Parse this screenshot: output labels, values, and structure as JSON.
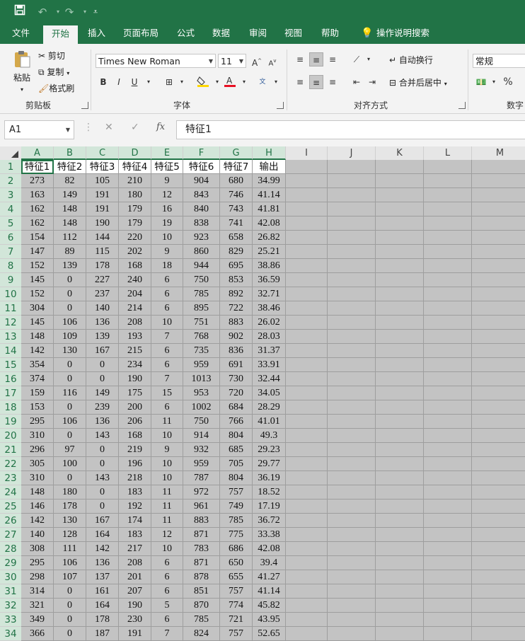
{
  "quick_access": {
    "save_icon": "save-icon",
    "undo_icon": "undo-icon",
    "redo_icon": "redo-icon"
  },
  "tabs": [
    "文件",
    "开始",
    "插入",
    "页面布局",
    "公式",
    "数据",
    "审阅",
    "视图",
    "帮助"
  ],
  "tell_me": "操作说明搜索",
  "ribbon": {
    "clipboard": {
      "paste": "粘贴",
      "cut": "剪切",
      "copy": "复制",
      "format_painter": "格式刷",
      "label": "剪贴板"
    },
    "font": {
      "font_name": "Times New Roman",
      "font_size": "11",
      "bold": "B",
      "italic": "I",
      "underline": "U",
      "font_color_accent": "#e81123",
      "fill_color_accent": "#ffd700",
      "label": "字体"
    },
    "alignment": {
      "wrap_text": "自动换行",
      "merge_center": "合并后居中",
      "label": "对齐方式"
    },
    "number": {
      "format": "常规",
      "percent": "%",
      "label": "数字"
    }
  },
  "formula_bar": {
    "name_box": "A1",
    "cancel": "✕",
    "enter": "✓",
    "fx": "fx",
    "content": "特征1"
  },
  "columns": [
    "A",
    "B",
    "C",
    "D",
    "E",
    "F",
    "G",
    "H",
    "I",
    "J",
    "K",
    "L",
    "M"
  ],
  "rows": [
    "1",
    "2",
    "3",
    "4",
    "5",
    "6",
    "7",
    "8",
    "9",
    "10",
    "11",
    "12",
    "13",
    "14",
    "15",
    "16",
    "17",
    "18",
    "19",
    "20",
    "21",
    "22",
    "23",
    "24",
    "25",
    "26",
    "27",
    "28",
    "29",
    "30",
    "31",
    "32",
    "33",
    "34"
  ],
  "headers": [
    "特征1",
    "特征2",
    "特征3",
    "特征4",
    "特征5",
    "特征6",
    "特征7",
    "输出"
  ],
  "data": [
    [
      "273",
      "82",
      "105",
      "210",
      "9",
      "904",
      "680",
      "34.99"
    ],
    [
      "163",
      "149",
      "191",
      "180",
      "12",
      "843",
      "746",
      "41.14"
    ],
    [
      "162",
      "148",
      "191",
      "179",
      "16",
      "840",
      "743",
      "41.81"
    ],
    [
      "162",
      "148",
      "190",
      "179",
      "19",
      "838",
      "741",
      "42.08"
    ],
    [
      "154",
      "112",
      "144",
      "220",
      "10",
      "923",
      "658",
      "26.82"
    ],
    [
      "147",
      "89",
      "115",
      "202",
      "9",
      "860",
      "829",
      "25.21"
    ],
    [
      "152",
      "139",
      "178",
      "168",
      "18",
      "944",
      "695",
      "38.86"
    ],
    [
      "145",
      "0",
      "227",
      "240",
      "6",
      "750",
      "853",
      "36.59"
    ],
    [
      "152",
      "0",
      "237",
      "204",
      "6",
      "785",
      "892",
      "32.71"
    ],
    [
      "304",
      "0",
      "140",
      "214",
      "6",
      "895",
      "722",
      "38.46"
    ],
    [
      "145",
      "106",
      "136",
      "208",
      "10",
      "751",
      "883",
      "26.02"
    ],
    [
      "148",
      "109",
      "139",
      "193",
      "7",
      "768",
      "902",
      "28.03"
    ],
    [
      "142",
      "130",
      "167",
      "215",
      "6",
      "735",
      "836",
      "31.37"
    ],
    [
      "354",
      "0",
      "0",
      "234",
      "6",
      "959",
      "691",
      "33.91"
    ],
    [
      "374",
      "0",
      "0",
      "190",
      "7",
      "1013",
      "730",
      "32.44"
    ],
    [
      "159",
      "116",
      "149",
      "175",
      "15",
      "953",
      "720",
      "34.05"
    ],
    [
      "153",
      "0",
      "239",
      "200",
      "6",
      "1002",
      "684",
      "28.29"
    ],
    [
      "295",
      "106",
      "136",
      "206",
      "11",
      "750",
      "766",
      "41.01"
    ],
    [
      "310",
      "0",
      "143",
      "168",
      "10",
      "914",
      "804",
      "49.3"
    ],
    [
      "296",
      "97",
      "0",
      "219",
      "9",
      "932",
      "685",
      "29.23"
    ],
    [
      "305",
      "100",
      "0",
      "196",
      "10",
      "959",
      "705",
      "29.77"
    ],
    [
      "310",
      "0",
      "143",
      "218",
      "10",
      "787",
      "804",
      "36.19"
    ],
    [
      "148",
      "180",
      "0",
      "183",
      "11",
      "972",
      "757",
      "18.52"
    ],
    [
      "146",
      "178",
      "0",
      "192",
      "11",
      "961",
      "749",
      "17.19"
    ],
    [
      "142",
      "130",
      "167",
      "174",
      "11",
      "883",
      "785",
      "36.72"
    ],
    [
      "140",
      "128",
      "164",
      "183",
      "12",
      "871",
      "775",
      "33.38"
    ],
    [
      "308",
      "111",
      "142",
      "217",
      "10",
      "783",
      "686",
      "42.08"
    ],
    [
      "295",
      "106",
      "136",
      "208",
      "6",
      "871",
      "650",
      "39.4"
    ],
    [
      "298",
      "107",
      "137",
      "201",
      "6",
      "878",
      "655",
      "41.27"
    ],
    [
      "314",
      "0",
      "161",
      "207",
      "6",
      "851",
      "757",
      "41.14"
    ],
    [
      "321",
      "0",
      "164",
      "190",
      "5",
      "870",
      "774",
      "45.82"
    ],
    [
      "349",
      "0",
      "178",
      "230",
      "6",
      "785",
      "721",
      "43.95"
    ],
    [
      "366",
      "0",
      "187",
      "191",
      "7",
      "824",
      "757",
      "52.65"
    ]
  ],
  "colors": {
    "brand": "#217346",
    "selected_header": "#d2e6d9",
    "grid_fill": "#c3c3c3"
  }
}
